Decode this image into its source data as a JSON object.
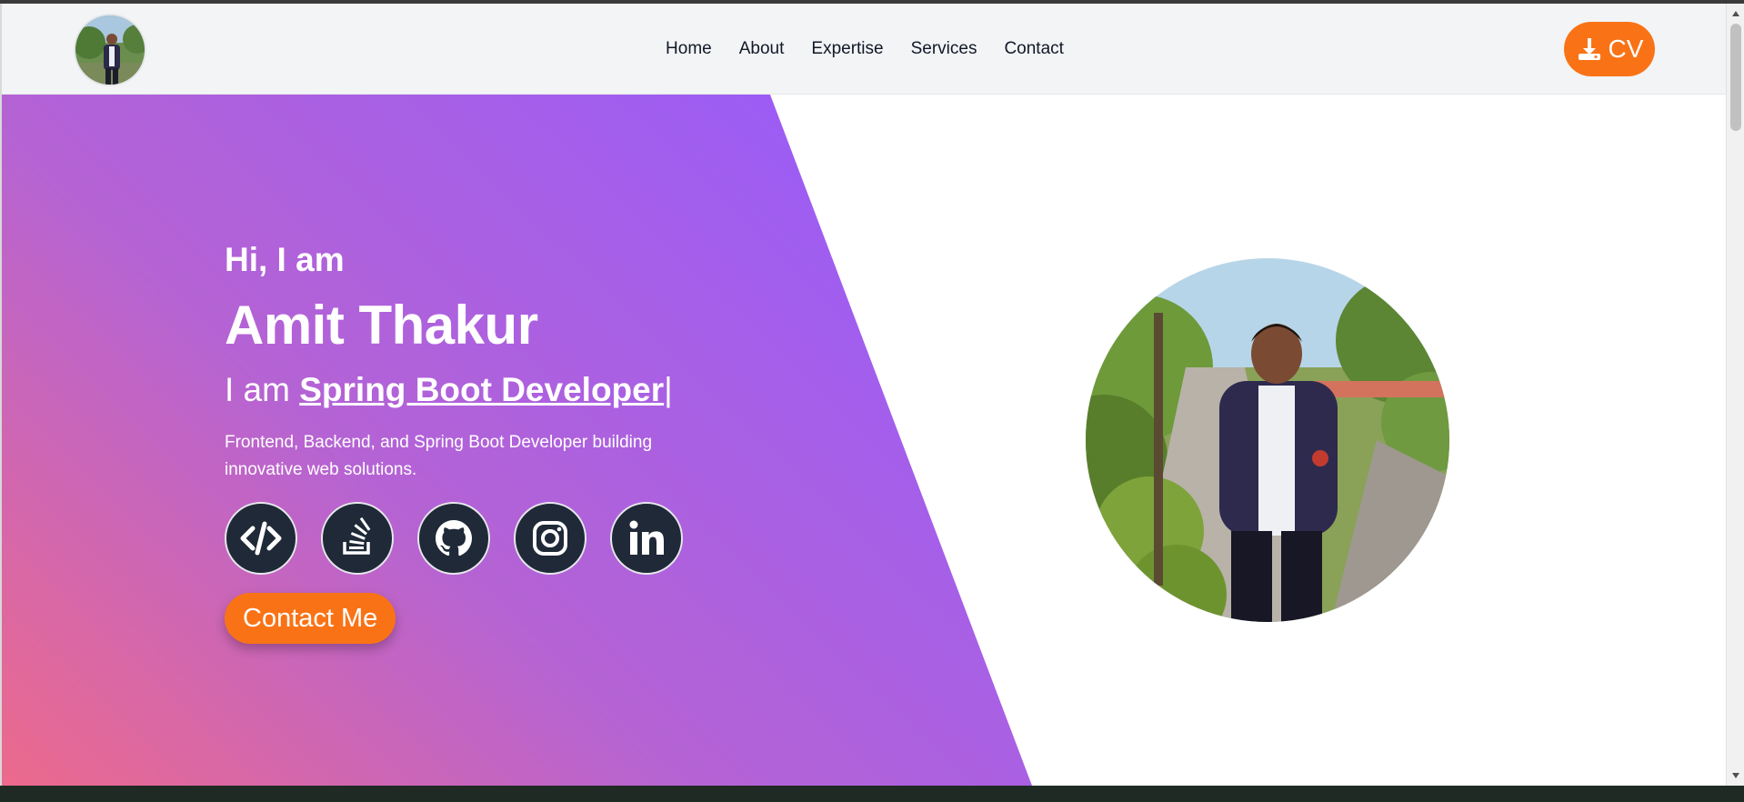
{
  "nav": {
    "links": [
      "Home",
      "About",
      "Expertise",
      "Services",
      "Contact"
    ],
    "cv_label": "CV",
    "cv_icon": "download-icon"
  },
  "hero": {
    "greeting": "Hi, I am",
    "name": "Amit Thakur",
    "role_prefix": "I am ",
    "role": "Spring Boot Developer",
    "cursor": "|",
    "tagline": "Frontend, Backend, and Spring Boot Developer building innovative web solutions.",
    "socials": [
      "code-icon",
      "stackoverflow-icon",
      "github-icon",
      "instagram-icon",
      "linkedin-icon"
    ],
    "contact_label": "Contact Me"
  },
  "colors": {
    "accent": "#f97316",
    "gradient_start": "#ec6a8c",
    "gradient_end": "#9b5cf6",
    "social_bg": "#1f2937",
    "nav_bg": "#f3f4f6"
  }
}
